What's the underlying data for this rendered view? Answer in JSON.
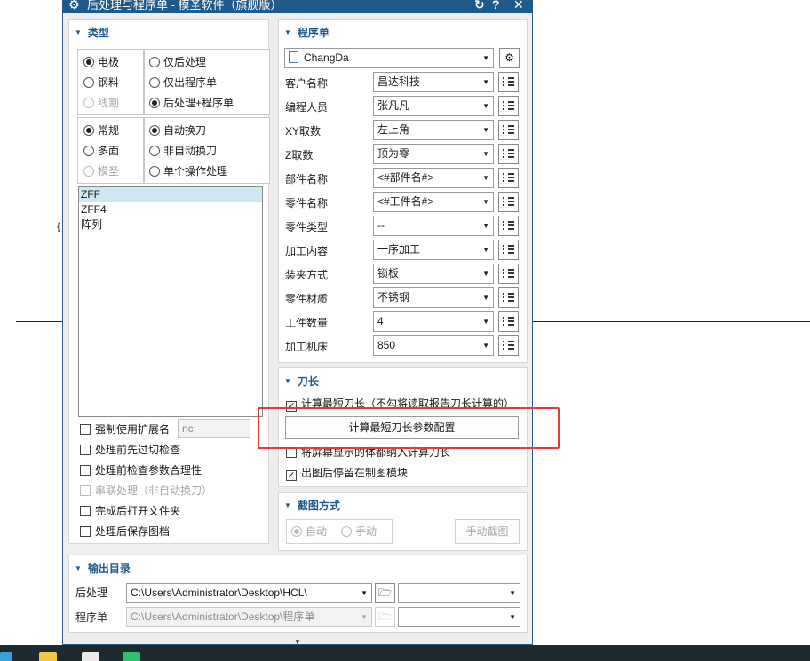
{
  "window": {
    "title": "后处理与程序单 - 模圣软件（旗舰版）"
  },
  "type_section": {
    "header": "类型",
    "material_options": [
      {
        "label": "电极",
        "selected": true,
        "disabled": false
      },
      {
        "label": "钢料",
        "selected": false,
        "disabled": false
      },
      {
        "label": "线割",
        "selected": false,
        "disabled": true
      }
    ],
    "process_options": [
      {
        "label": "仅后处理",
        "selected": false
      },
      {
        "label": "仅出程序单",
        "selected": false
      },
      {
        "label": "后处理+程序单",
        "selected": true
      }
    ],
    "mode_options": [
      {
        "label": "常规",
        "selected": true,
        "disabled": false
      },
      {
        "label": "多面",
        "selected": false,
        "disabled": false
      },
      {
        "label": "模圣",
        "selected": false,
        "disabled": true
      }
    ],
    "toolchange_options": [
      {
        "label": "自动换刀",
        "selected": true
      },
      {
        "label": "非自动换刀",
        "selected": false
      },
      {
        "label": "单个操作处理",
        "selected": false
      }
    ],
    "post_list": [
      {
        "label": "ZFF",
        "selected": true
      },
      {
        "label": "ZFF4",
        "selected": false
      },
      {
        "label": "阵列",
        "selected": false
      }
    ],
    "force_ext_label": "强制使用扩展名",
    "force_ext_value": "nc",
    "options": [
      {
        "label": "处理前先过切检查",
        "checked": false,
        "disabled": false
      },
      {
        "label": "处理前检查参数合理性",
        "checked": false,
        "disabled": false
      },
      {
        "label": "串联处理（非自动换刀）",
        "checked": false,
        "disabled": true
      },
      {
        "label": "完成后打开文件夹",
        "checked": false,
        "disabled": false
      },
      {
        "label": "处理后保存图档",
        "checked": false,
        "disabled": false
      }
    ]
  },
  "program_section": {
    "header": "程序单",
    "template": "ChangDa",
    "fields": [
      {
        "label": "客户名称",
        "value": "昌达科技"
      },
      {
        "label": "编程人员",
        "value": "张凡凡"
      },
      {
        "label": "XY取数",
        "value": "左上角"
      },
      {
        "label": "Z取数",
        "value": "顶为零"
      },
      {
        "label": "部件名称",
        "value": "<#部件名#>"
      },
      {
        "label": "零件名称",
        "value": "<#工件名#>"
      },
      {
        "label": "零件类型",
        "value": "--"
      },
      {
        "label": "加工内容",
        "value": "一序加工"
      },
      {
        "label": "装夹方式",
        "value": "锁板"
      },
      {
        "label": "零件材质",
        "value": "不锈钢"
      },
      {
        "label": "工件数量",
        "value": "4"
      },
      {
        "label": "加工机床",
        "value": "850"
      }
    ]
  },
  "tool_section": {
    "header": "刀长",
    "calc_check_label": "计算最短刀长（不勾将读取报告刀长计算的）",
    "calc_checked": true,
    "config_button": "计算最短刀长参数配置",
    "include_check_label": "将屏幕显示的体都纳入计算刀长",
    "include_checked": false,
    "stay_check_label": "出图后停留在制图模块",
    "stay_checked": true
  },
  "screenshot_section": {
    "header": "截图方式",
    "auto_label": "自动",
    "manual_label": "手动",
    "auto_selected": true,
    "manual_button": "手动截图"
  },
  "output_section": {
    "header": "输出目录",
    "post_label": "后处理",
    "post_path": "C:\\Users\\Administrator\\Desktop\\HCL\\",
    "sheet_label": "程序单",
    "sheet_path": "C:\\Users\\Administrator\\Desktop\\程序单"
  },
  "colors": {
    "title_bar": "#1f5a8c",
    "section_header": "#1f5a8c",
    "highlight_box": "#e23b3b",
    "list_selection": "#cde8f0"
  }
}
